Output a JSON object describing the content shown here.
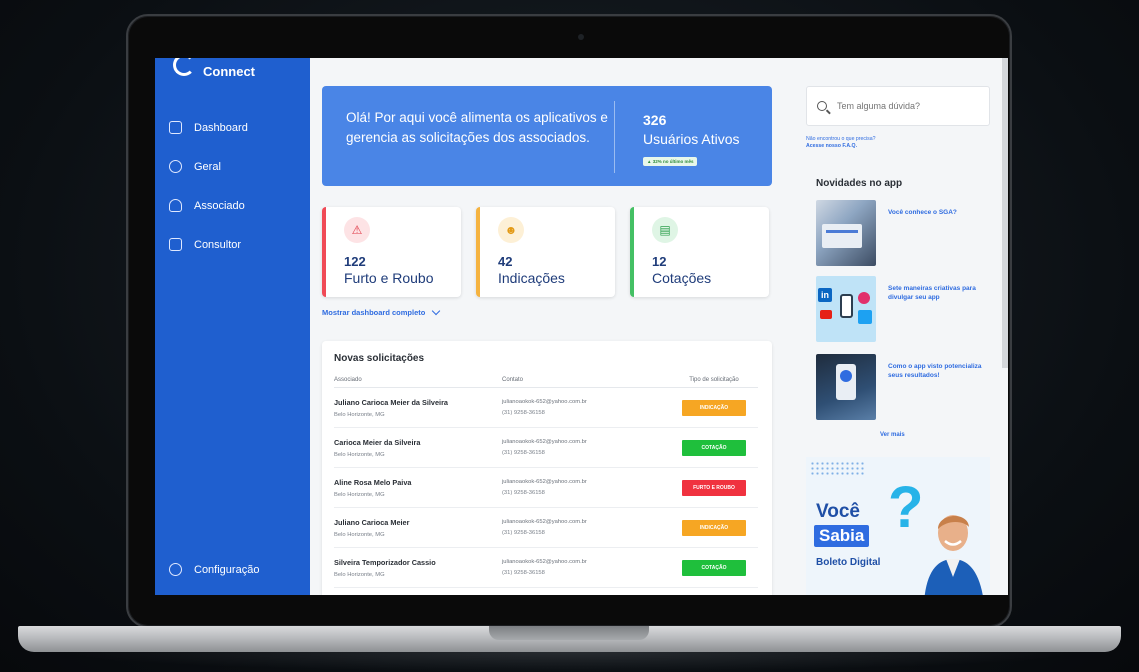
{
  "sidebar": {
    "brand": "Connect",
    "items": [
      {
        "label": "Dashboard",
        "icon": "monitor-icon"
      },
      {
        "label": "Geral",
        "icon": "globe-icon"
      },
      {
        "label": "Associado",
        "icon": "user-icon"
      },
      {
        "label": "Consultor",
        "icon": "badge-icon"
      }
    ],
    "settings": {
      "label": "Configuração",
      "icon": "gear-icon"
    },
    "color": "#1f5fcf"
  },
  "hero": {
    "message": "Olá! Por aqui você alimenta os aplicativos e gerencia as solicitações dos associados.",
    "active_users": "326",
    "active_users_label": "Usuários Ativos",
    "growth_badge": "▲ 32% no último mês",
    "color": "#4a85e6"
  },
  "cards": [
    {
      "count": "122",
      "label": "Furto e Roubo",
      "icon": "alarm-icon",
      "color": "#f04a56"
    },
    {
      "count": "42",
      "label": "Indicações",
      "icon": "user-plus-icon",
      "color": "#f5b340"
    },
    {
      "count": "12",
      "label": "Cotações",
      "icon": "document-icon",
      "color": "#44c064"
    }
  ],
  "show_more": "Mostrar dashboard completo",
  "requests": {
    "title": "Novas solicitações",
    "columns": [
      "Associado",
      "Contato",
      "Tipo de solicitação"
    ],
    "rows": [
      {
        "name": "Juliano Carioca Meier da Silveira",
        "city": "Belo Horizonte, MG",
        "email": "julianoaokok-652@yahoo.com.br",
        "phone": "(31) 9258-36158",
        "type": "INDICAÇÃO",
        "type_color": "#f6a623"
      },
      {
        "name": "Carioca Meier da Silveira",
        "city": "Belo Horizonte, MG",
        "email": "julianoaokok-652@yahoo.com.br",
        "phone": "(31) 9258-36158",
        "type": "COTAÇÃO",
        "type_color": "#1fbf3c"
      },
      {
        "name": "Aline Rosa Melo Paiva",
        "city": "Belo Horizonte, MG",
        "email": "julianoaokok-652@yahoo.com.br",
        "phone": "(31) 9258-36158",
        "type": "FURTO E ROUBO",
        "type_color": "#f0323f"
      },
      {
        "name": "Juliano Carioca Meier",
        "city": "Belo Horizonte, MG",
        "email": "julianoaokok-652@yahoo.com.br",
        "phone": "(31) 9258-36158",
        "type": "INDICAÇÃO",
        "type_color": "#f6a623"
      },
      {
        "name": "Silveira Temporizador Cassio",
        "city": "Belo Horizonte, MG",
        "email": "julianoaokok-652@yahoo.com.br",
        "phone": "(31) 9258-36158",
        "type": "COTAÇÃO",
        "type_color": "#1fbf3c"
      }
    ]
  },
  "help": {
    "search_placeholder": "Tem alguma dúvida?",
    "faq_line1": "Não encontrou o que precisa?",
    "faq_line2": "Acesse nosso F.A.Q."
  },
  "news": {
    "title": "Novidades no app",
    "items": [
      {
        "text": "Você conhece o SGA?"
      },
      {
        "text": "Sete maneiras criativas para divulgar seu app"
      },
      {
        "text": "Como o app visto potencializa seus resultados!"
      }
    ],
    "see_more": "Ver mais"
  },
  "banner": {
    "line1": "Você",
    "line2": "Sabia",
    "question": "?",
    "subtitle": "Boleto Digital"
  }
}
